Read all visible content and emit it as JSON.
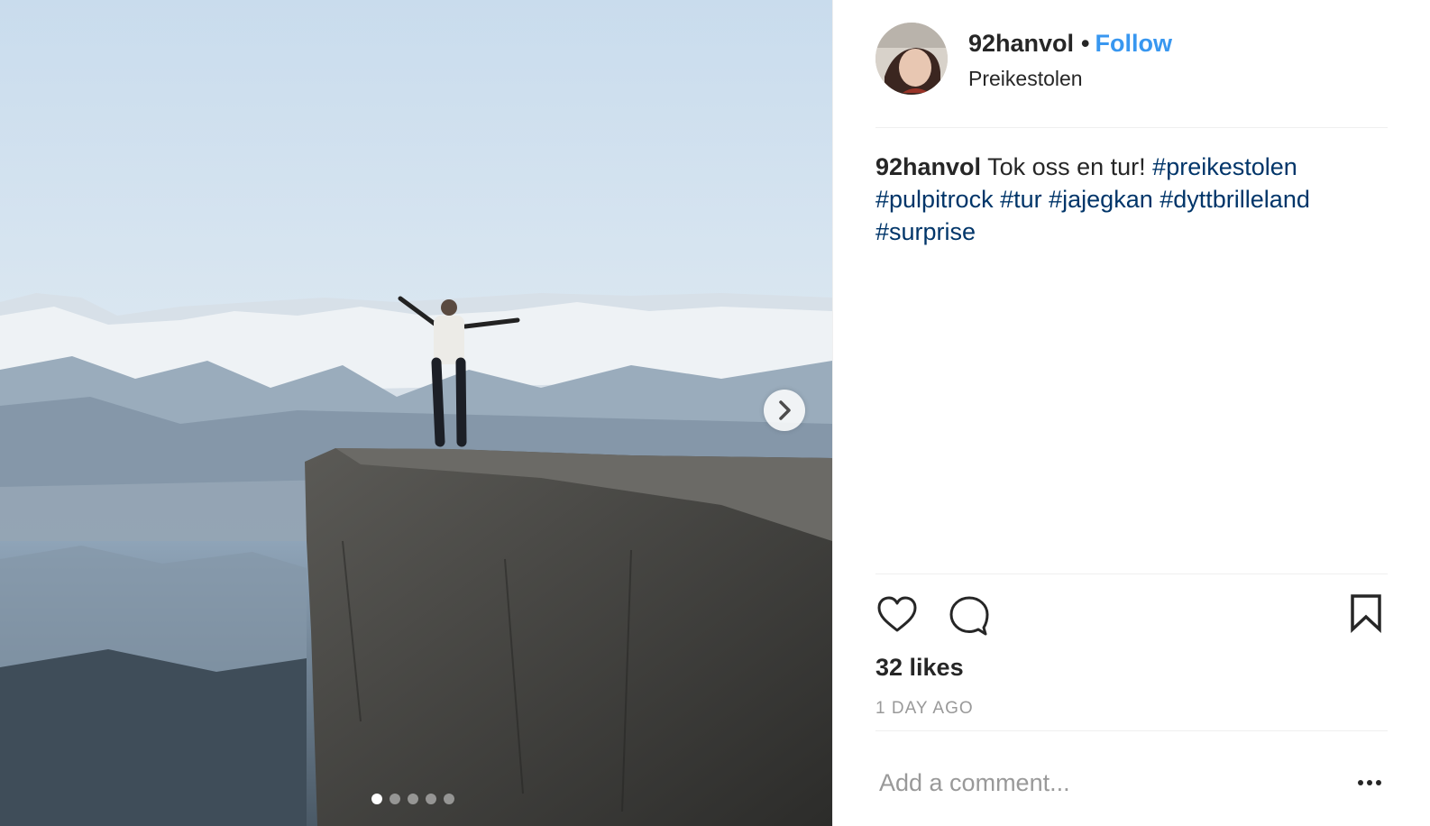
{
  "post": {
    "username": "92hanvol",
    "separator": "•",
    "follow_label": "Follow",
    "location": "Preikestolen",
    "caption": {
      "username": "92hanvol",
      "text": "Tok oss en tur!",
      "hashtags": [
        "#preikestolen",
        "#pulpitrock",
        "#tur",
        "#jajegkan",
        "#dyttbrilleland",
        "#surprise"
      ]
    },
    "likes": "32 likes",
    "time": "1 DAY AGO",
    "comment_placeholder": "Add a comment...",
    "carousel": {
      "total": 5,
      "current": 1
    }
  },
  "icons": {
    "next": "chevron-right-icon",
    "like": "heart-icon",
    "comment": "speech-bubble-icon",
    "save": "bookmark-icon",
    "more": "more-options-icon"
  },
  "colors": {
    "follow": "#3897f0",
    "hashtag": "#003569",
    "muted": "#999999",
    "text": "#262626"
  }
}
